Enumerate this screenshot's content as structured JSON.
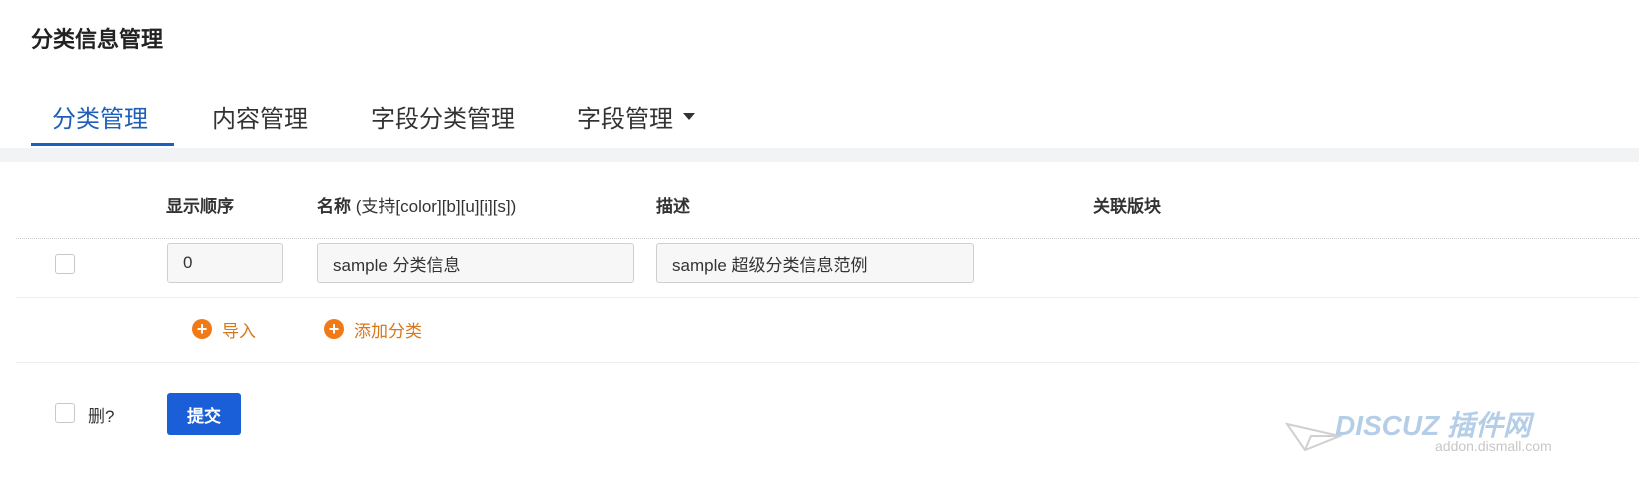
{
  "page_title": "分类信息管理",
  "tabs": [
    {
      "label": "分类管理",
      "active": true
    },
    {
      "label": "内容管理",
      "active": false
    },
    {
      "label": "字段分类管理",
      "active": false
    },
    {
      "label": "字段管理",
      "active": false,
      "dropdown": true
    }
  ],
  "columns": {
    "order": "显示顺序",
    "name": "名称",
    "name_hint": "(支持[color][b][u][i][s])",
    "description": "描述",
    "forums": "关联版块"
  },
  "rows": [
    {
      "checked": false,
      "order": "0",
      "name": "sample 分类信息",
      "description": "sample 超级分类信息范例"
    }
  ],
  "actions": {
    "import": "导入",
    "add_category": "添加分类"
  },
  "footer": {
    "delete_label": "删?",
    "submit_label": "提交"
  },
  "watermark": {
    "text": "DISCUZ 插件网",
    "url": "addon.dismall.com"
  },
  "colors": {
    "active_tab": "#1f5fb8",
    "accent_orange": "#f07a18",
    "submit_blue": "#1a5fd8"
  }
}
